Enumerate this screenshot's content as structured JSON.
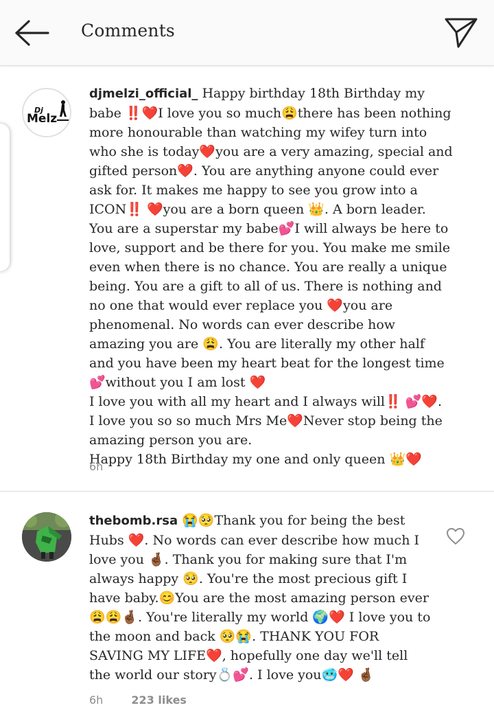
{
  "header": {
    "title": "Comments"
  },
  "comments": [
    {
      "username": "djmelzi_official_",
      "avatar_text": "Melz",
      "avatar_text_small": "Dj",
      "text": "Happy birthday 18th Birthday my babe ‼️❤️I love you so much😩there has been nothing more honourable than watching my wifey turn into who she is today❤️you are a very amazing, special and gifted person❤️. You are anything anyone could ever ask for. It makes me happy to see you grow into a ICON‼️ ❤️you are a born queen 👑. A born leader. You are a superstar my babe💕I will always be here to love, support and be there for you. You make me smile even when there is no chance. You are really a unique being. You are a gift to all of us. There is nothing and no one that would ever replace you ❤️you are phenomenal. No words can ever describe how amazing you are 😩. You are literally my other half and you have been my heart beat for the longest time💕without you I am lost ❤️\nI love you with all my heart and I always will‼️ 💕❤️.\nI love you so so much Mrs Me❤️Never stop being the amazing person you are.\nHappy 18th Birthday my one and only queen 👑❤️",
      "time": "6h"
    },
    {
      "username": "thebomb.rsa",
      "text": "😭🥺Thank you for being the best Hubs ❤️. No words can ever describe how much I love you 🤞🏾. Thank you for making sure that I'm always happy 🥺. You're the most precious gift I have baby.😊You are the most amazing person ever😩😩🤞🏾. You're literally my world 🌍❤️ I love you to the moon and back 🥺😭. THANK YOU FOR SAVING MY LIFE❤️, hopefully one day we'll tell the world our story💍💕. I love you🥶❤️ 🤞🏾",
      "time": "6h",
      "likes": "223 likes"
    }
  ],
  "colors": {
    "header_bg": "#fafafa",
    "text": "#262626",
    "meta": "#8e8e8e",
    "divider": "#dcdcdc"
  },
  "icons": {
    "back": "arrow-left-icon",
    "send": "paper-plane-icon",
    "like": "heart-outline-icon"
  }
}
